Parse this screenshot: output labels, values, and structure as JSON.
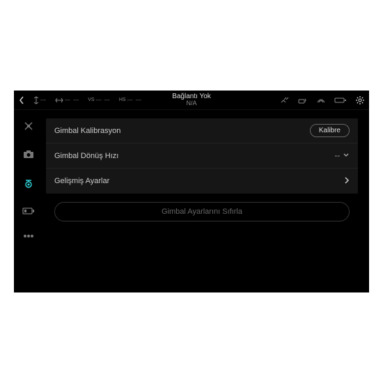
{
  "topbar": {
    "connection_title": "Bağlantı Yok",
    "connection_sub": "N/A",
    "left_readouts": [
      "—",
      "— —",
      "— —",
      "— —"
    ]
  },
  "settings": {
    "rows": [
      {
        "label": "Gimbal Kalibrasyon",
        "action_label": "Kalibre"
      },
      {
        "label": "Gimbal Dönüş Hızı",
        "value": "--"
      },
      {
        "label": "Gelişmiş Ayarlar"
      }
    ],
    "reset_label": "Gimbal Ayarlarını Sıfırla"
  }
}
